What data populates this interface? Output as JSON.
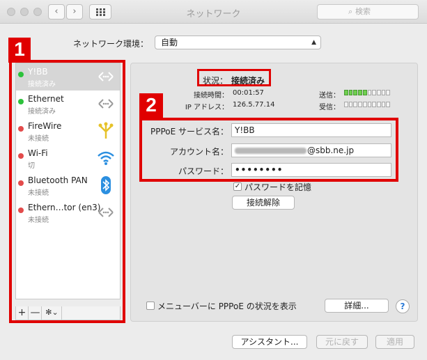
{
  "window": {
    "title": "ネットワーク",
    "search_placeholder": "検索",
    "nav_back": "‹",
    "nav_forward": "›"
  },
  "location": {
    "label": "ネットワーク環境：",
    "value": "自動"
  },
  "annotations": {
    "badge1": "1",
    "badge2": "2",
    "color": "#e00000"
  },
  "sidebar": {
    "items": [
      {
        "name": "Y!BB",
        "status": "接続済み",
        "status_color": "#2cc23b",
        "icon": "ppp-arrows-icon"
      },
      {
        "name": "Ethernet",
        "status": "接続済み",
        "status_color": "#2cc23b",
        "icon": "ethernet-arrows-icon"
      },
      {
        "name": "FireWire",
        "status": "未接続",
        "status_color": "#e34b4b",
        "icon": "firewire-icon"
      },
      {
        "name": "Wi-Fi",
        "status": "切",
        "status_color": "#e34b4b",
        "icon": "wifi-icon"
      },
      {
        "name": "Bluetooth PAN",
        "status": "未接続",
        "status_color": "#e34b4b",
        "icon": "bluetooth-icon"
      },
      {
        "name": "Ethern…tor (en3)",
        "status": "未接続",
        "status_color": "#e34b4b",
        "icon": "ethernet-arrows-icon"
      }
    ],
    "tools": {
      "add": "+",
      "remove": "—",
      "gear": "✻⌄"
    }
  },
  "status": {
    "label": "状況：",
    "value": "接続済み",
    "connect_time_label": "接続時間：",
    "connect_time": "00:01:57",
    "ip_label": "IP アドレス：",
    "ip": "126.5.77.14",
    "send_label": "送信：",
    "receive_label": "受信：",
    "send_level_segments": 5,
    "receive_level_segments": 0
  },
  "form": {
    "service_label": "PPPoE サービス名：",
    "service_value": "Y!BB",
    "account_label": "アカウント名：",
    "account_value": "@sbb.ne.jp",
    "password_label": "パスワード：",
    "password_value": "••••••••",
    "remember_label": "パスワードを記憶",
    "remember_checked": "✓",
    "disconnect_button": "接続解除"
  },
  "footer": {
    "menubar_label": "メニューバーに PPPoE の状況を表示",
    "details_button": "詳細...",
    "help": "?",
    "assistant_button": "アシスタント...",
    "revert_button": "元に戻す",
    "apply_button": "適用"
  }
}
